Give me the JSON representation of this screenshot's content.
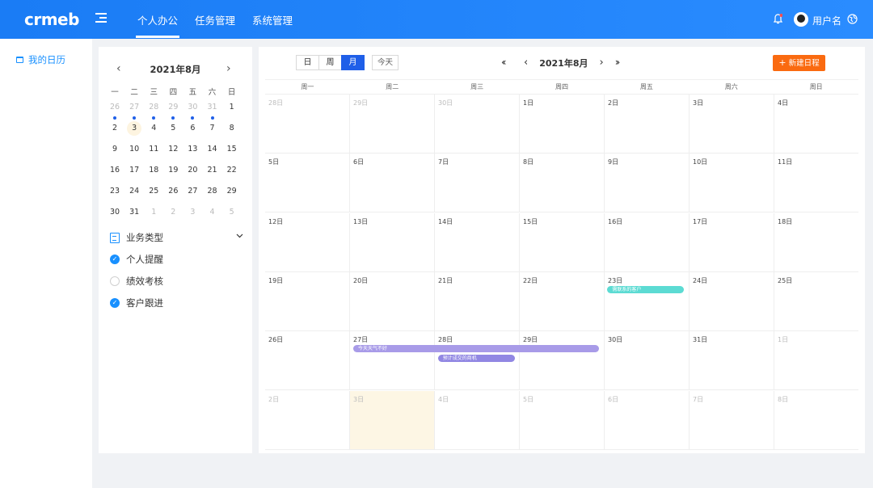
{
  "app": {
    "logo": "crmeb",
    "nav": [
      "个人办公",
      "任务管理",
      "系统管理"
    ],
    "username": "用户名"
  },
  "sidebar": {
    "items": [
      {
        "label": "我的日历"
      }
    ]
  },
  "mini_calendar": {
    "title": "2021年8月",
    "weekdays": [
      "一",
      "二",
      "三",
      "四",
      "五",
      "六",
      "日"
    ],
    "weeks": [
      [
        {
          "d": "26",
          "m": true
        },
        {
          "d": "27",
          "m": true
        },
        {
          "d": "28",
          "m": true
        },
        {
          "d": "29",
          "m": true
        },
        {
          "d": "30",
          "m": true
        },
        {
          "d": "31",
          "m": true
        },
        {
          "d": "1"
        }
      ],
      [
        {
          "d": "2"
        },
        {
          "d": "3",
          "today": true
        },
        {
          "d": "4"
        },
        {
          "d": "5"
        },
        {
          "d": "6"
        },
        {
          "d": "7"
        },
        {
          "d": "8"
        }
      ],
      [
        {
          "d": "9"
        },
        {
          "d": "10"
        },
        {
          "d": "11"
        },
        {
          "d": "12"
        },
        {
          "d": "13"
        },
        {
          "d": "14"
        },
        {
          "d": "15"
        }
      ],
      [
        {
          "d": "16"
        },
        {
          "d": "17"
        },
        {
          "d": "18"
        },
        {
          "d": "19"
        },
        {
          "d": "20"
        },
        {
          "d": "21"
        },
        {
          "d": "22"
        }
      ],
      [
        {
          "d": "23"
        },
        {
          "d": "24"
        },
        {
          "d": "25"
        },
        {
          "d": "26"
        },
        {
          "d": "27"
        },
        {
          "d": "28"
        },
        {
          "d": "29"
        }
      ],
      [
        {
          "d": "30"
        },
        {
          "d": "31"
        },
        {
          "d": "1",
          "m": true
        },
        {
          "d": "2",
          "m": true
        },
        {
          "d": "3",
          "m": true
        },
        {
          "d": "4",
          "m": true
        },
        {
          "d": "5",
          "m": true
        }
      ]
    ],
    "dots": [
      true,
      true,
      true,
      true,
      true,
      true,
      false
    ]
  },
  "business": {
    "title": "业务类型",
    "items": [
      {
        "label": "个人提醒",
        "checked": true
      },
      {
        "label": "绩效考核",
        "checked": false
      },
      {
        "label": "客户跟进",
        "checked": true
      }
    ]
  },
  "calendar": {
    "views": [
      "日",
      "周",
      "月"
    ],
    "active_view": "月",
    "today_label": "今天",
    "title": "2021年8月",
    "new_button": "新建日程",
    "weekdays": [
      "周一",
      "周二",
      "周三",
      "周四",
      "周五",
      "周六",
      "周日"
    ],
    "weeks": [
      [
        {
          "d": "28日",
          "m": true
        },
        {
          "d": "29日",
          "m": true
        },
        {
          "d": "30日",
          "m": true
        },
        {
          "d": "1日"
        },
        {
          "d": "2日"
        },
        {
          "d": "3日"
        },
        {
          "d": "4日"
        }
      ],
      [
        {
          "d": "5日"
        },
        {
          "d": "6日"
        },
        {
          "d": "7日"
        },
        {
          "d": "8日"
        },
        {
          "d": "9日"
        },
        {
          "d": "10日"
        },
        {
          "d": "11日"
        }
      ],
      [
        {
          "d": "12日"
        },
        {
          "d": "13日"
        },
        {
          "d": "14日"
        },
        {
          "d": "15日"
        },
        {
          "d": "16日"
        },
        {
          "d": "17日"
        },
        {
          "d": "18日"
        }
      ],
      [
        {
          "d": "19日"
        },
        {
          "d": "20日"
        },
        {
          "d": "21日"
        },
        {
          "d": "22日"
        },
        {
          "d": "23日"
        },
        {
          "d": "24日"
        },
        {
          "d": "25日"
        }
      ],
      [
        {
          "d": "26日"
        },
        {
          "d": "27日"
        },
        {
          "d": "28日"
        },
        {
          "d": "29日"
        },
        {
          "d": "30日"
        },
        {
          "d": "31日"
        },
        {
          "d": "1日",
          "m": true
        }
      ],
      [
        {
          "d": "2日",
          "m": true
        },
        {
          "d": "3日",
          "m": true,
          "hl": true
        },
        {
          "d": "4日",
          "m": true
        },
        {
          "d": "5日",
          "m": true
        },
        {
          "d": "6日",
          "m": true
        },
        {
          "d": "7日",
          "m": true
        },
        {
          "d": "8日",
          "m": true
        }
      ]
    ],
    "events": [
      {
        "label": "需联系的客户",
        "week": 3,
        "start": 4,
        "span": 1,
        "lane": 0,
        "color": "cyan"
      },
      {
        "label": "今天天气不好",
        "week": 4,
        "start": 1,
        "span": 3,
        "lane": 0,
        "color": "purple"
      },
      {
        "label": "预计成交的商机",
        "week": 4,
        "start": 2,
        "span": 1,
        "lane": 1,
        "color": "purple-dark"
      }
    ]
  }
}
